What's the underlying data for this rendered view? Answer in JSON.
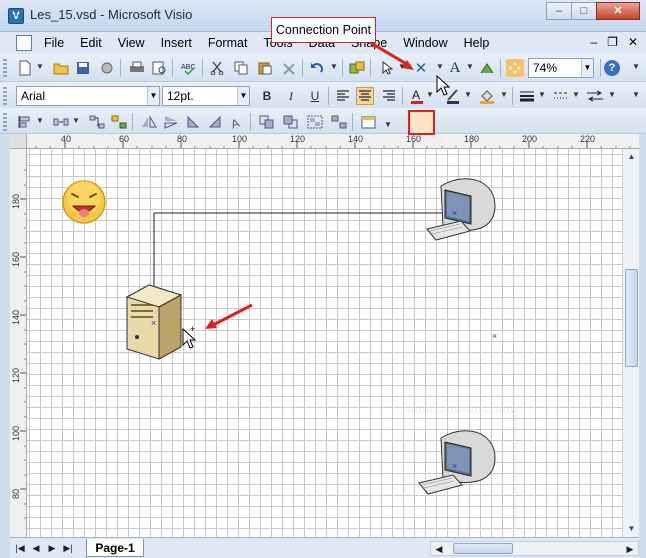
{
  "window": {
    "title": "Les_15.vsd - Microsoft Visio",
    "app_icon_glyph": "V",
    "minimize_glyph": "–",
    "maximize_glyph": "□",
    "close_glyph": "✕"
  },
  "menu": {
    "items": [
      "File",
      "Edit",
      "View",
      "Insert",
      "Format",
      "Tools",
      "Data",
      "Shape",
      "Window",
      "Help"
    ],
    "doc_controls": [
      "–",
      "❐",
      "✕"
    ]
  },
  "toolbar": {
    "zoom": "74%",
    "font_name": "Arial",
    "font_size": "12pt.",
    "bold": "B",
    "italic": "I",
    "underline": "U",
    "text_tool": "A",
    "connection_point_tool": "✕",
    "help": "?"
  },
  "callout": {
    "text": "Connection Point"
  },
  "ruler": {
    "top_labels": [
      "40",
      "60",
      "80",
      "100",
      "120",
      "140",
      "160",
      "180",
      "200",
      "220"
    ],
    "left_labels": [
      "180",
      "160",
      "140",
      "120",
      "100",
      "80"
    ]
  },
  "status": {
    "page_tab": "Page-1"
  },
  "colors": {
    "accent_red": "#e21f1f",
    "grid": "#c9c9c9",
    "connector_point": "#2a2ad0"
  }
}
